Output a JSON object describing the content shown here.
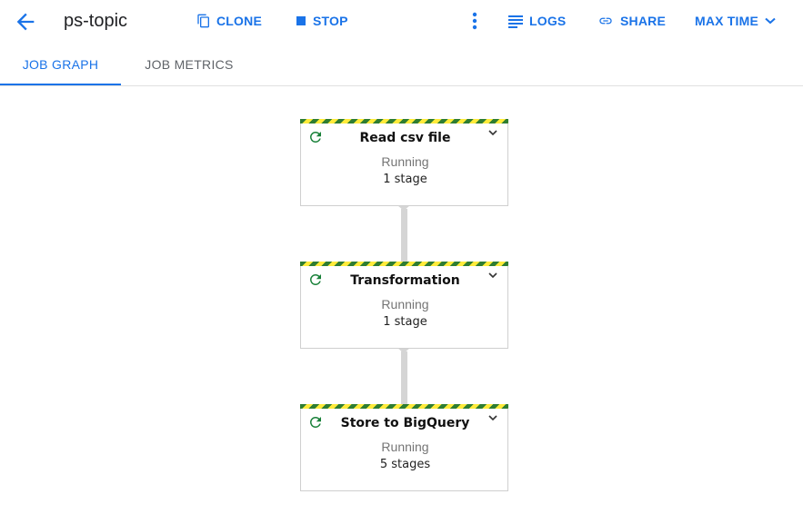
{
  "header": {
    "title": "ps-topic",
    "clone_label": "CLONE",
    "stop_label": "STOP",
    "logs_label": "LOGS",
    "share_label": "SHARE",
    "time_label": "MAX TIME"
  },
  "tabs": [
    {
      "label": "JOB GRAPH",
      "active": true
    },
    {
      "label": "JOB METRICS",
      "active": false
    }
  ],
  "colors": {
    "accent": "#1a73e8",
    "running": "#188038",
    "stripe_green": "#2e7d32",
    "stripe_yellow": "#ffeb3b"
  },
  "graph": {
    "nodes": [
      {
        "name": "Read csv file",
        "status": "Running",
        "stages": "1 stage"
      },
      {
        "name": "Transformation",
        "status": "Running",
        "stages": "1 stage"
      },
      {
        "name": "Store to BigQuery",
        "status": "Running",
        "stages": "5 stages"
      }
    ]
  },
  "icons": {
    "back": "arrow-back-icon",
    "clone": "copy-icon",
    "stop": "stop-icon",
    "more": "more-vert-icon",
    "logs": "list-icon",
    "share": "link-icon",
    "time": "chevron-down-icon",
    "node_status": "refresh-running-icon",
    "node_expand": "chevron-down-icon"
  }
}
